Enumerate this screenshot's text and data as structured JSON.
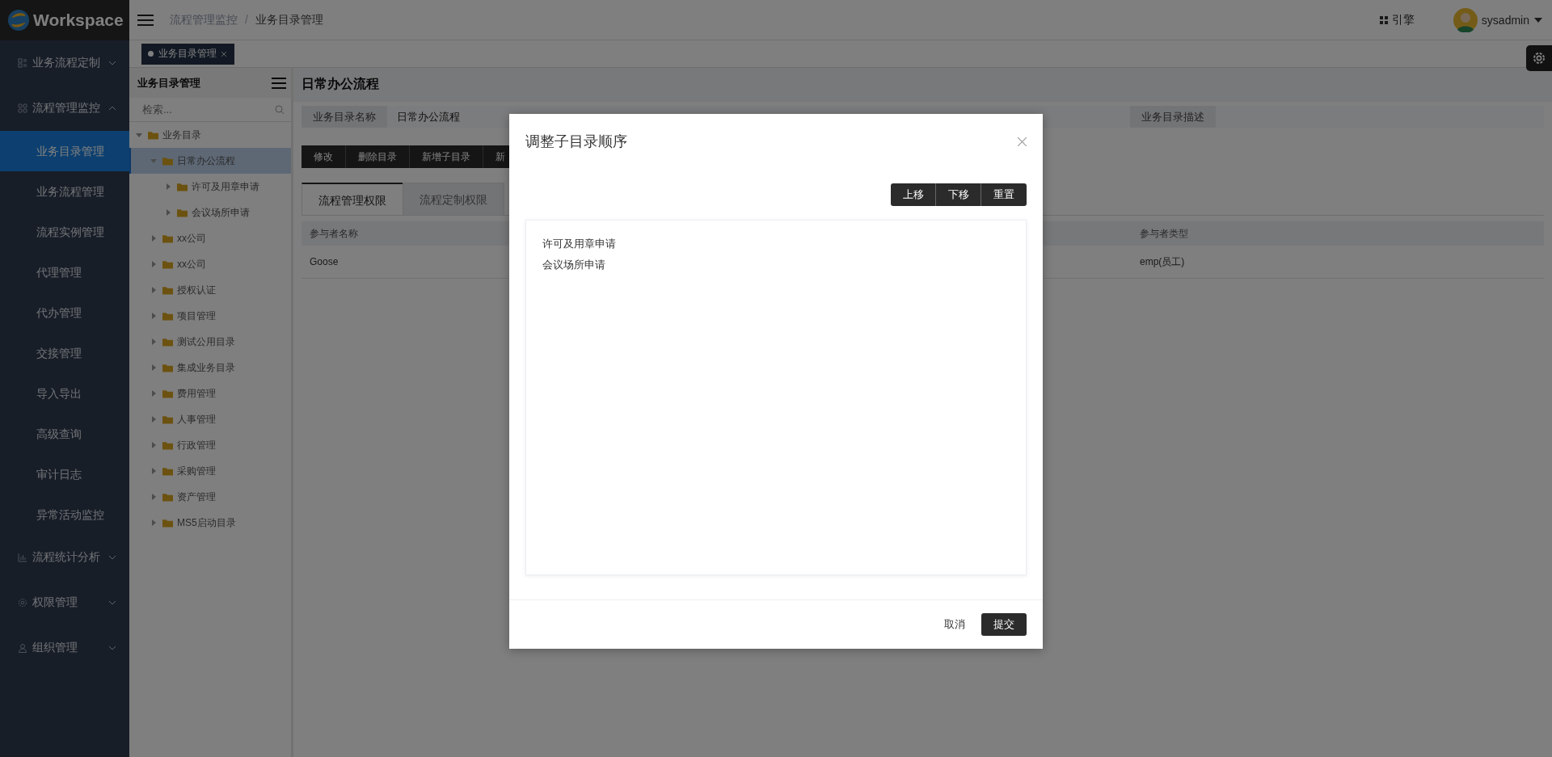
{
  "brand": {
    "name": "Workspace"
  },
  "breadcrumb_separator": "/",
  "breadcrumb": [
    {
      "label": "流程管理监控"
    },
    {
      "label": "业务目录管理"
    }
  ],
  "header": {
    "engine_label": "引擎",
    "user": "sysadmin"
  },
  "page_tabs": [
    {
      "label": "业务目录管理",
      "selected": true
    }
  ],
  "sidebar": {
    "items": [
      {
        "label": "业务流程定制",
        "expanded": false
      },
      {
        "label": "流程管理监控",
        "expanded": true,
        "children": [
          {
            "label": "业务目录管理",
            "selected": true
          },
          {
            "label": "业务流程管理",
            "selected": false
          },
          {
            "label": "流程实例管理",
            "selected": false
          },
          {
            "label": "代理管理",
            "selected": false
          },
          {
            "label": "代办管理",
            "selected": false
          },
          {
            "label": "交接管理",
            "selected": false
          },
          {
            "label": "导入导出",
            "selected": false
          },
          {
            "label": "高级查询",
            "selected": false
          },
          {
            "label": "审计日志",
            "selected": false
          },
          {
            "label": "异常活动监控",
            "selected": false
          }
        ]
      },
      {
        "label": "流程统计分析",
        "expanded": false
      },
      {
        "label": "权限管理",
        "expanded": false
      },
      {
        "label": "组织管理",
        "expanded": false
      }
    ]
  },
  "tree": {
    "title": "业务目录管理",
    "search_placeholder": "检索...",
    "nodes": [
      {
        "label": "业务目录",
        "expanded": true,
        "selected": false,
        "children": [
          {
            "label": "日常办公流程",
            "expanded": true,
            "selected": true,
            "children": [
              {
                "label": "许可及用章申请",
                "expanded": false,
                "selected": false
              },
              {
                "label": "会议场所申请",
                "expanded": false,
                "selected": false
              }
            ]
          },
          {
            "label": "xx公司",
            "expanded": false,
            "selected": false
          },
          {
            "label": "xx公司",
            "expanded": false,
            "selected": false
          },
          {
            "label": "授权认证",
            "expanded": false,
            "selected": false
          },
          {
            "label": "项目管理",
            "expanded": false,
            "selected": false
          },
          {
            "label": "测试公用目录",
            "expanded": false,
            "selected": false
          },
          {
            "label": "集成业务目录",
            "expanded": false,
            "selected": false
          },
          {
            "label": "费用管理",
            "expanded": false,
            "selected": false
          },
          {
            "label": "人事管理",
            "expanded": false,
            "selected": false
          },
          {
            "label": "行政管理",
            "expanded": false,
            "selected": false
          },
          {
            "label": "采购管理",
            "expanded": false,
            "selected": false
          },
          {
            "label": "资产管理",
            "expanded": false,
            "selected": false
          },
          {
            "label": "MS5启动目录",
            "expanded": false,
            "selected": false
          }
        ]
      }
    ]
  },
  "detail": {
    "title": "日常办公流程",
    "fields": [
      {
        "label": "业务目录名称",
        "value": "日常办公流程"
      },
      {
        "label": "业务目录描述"
      }
    ],
    "toolbar": [
      "修改",
      "删除目录",
      "新增子目录",
      "新"
    ],
    "tabs": [
      {
        "label": "流程管理权限",
        "selected": true
      },
      {
        "label": "流程定制权限",
        "selected": false
      }
    ],
    "table": {
      "columns": [
        "参与者名称",
        "参与者类型"
      ],
      "rows": [
        [
          "Goose",
          "emp(员工)"
        ]
      ]
    }
  },
  "modal": {
    "title": "调整子目录顺序",
    "actions": [
      "上移",
      "下移",
      "重置"
    ],
    "items": [
      "许可及用章申请",
      "会议场所申请"
    ],
    "cancel": "取消",
    "submit": "提交"
  }
}
